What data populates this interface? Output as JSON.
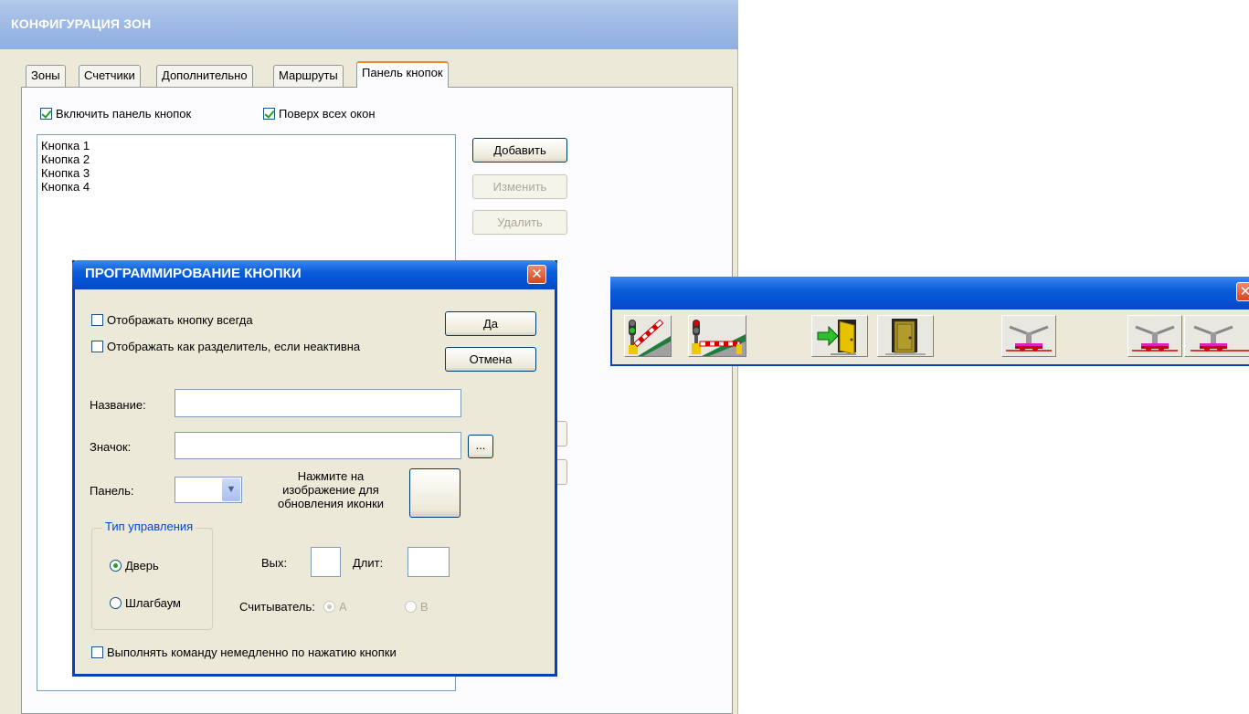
{
  "main_window": {
    "title": "КОНФИГУРАЦИЯ ЗОН",
    "tabs": [
      {
        "label": "Зоны",
        "active": false
      },
      {
        "label": "Счетчики",
        "active": false
      },
      {
        "label": "Дополнительно",
        "active": false
      },
      {
        "label": "Маршруты",
        "active": false
      },
      {
        "label": "Панель кнопок",
        "active": true
      }
    ],
    "enable_panel": {
      "label": "Включить панель кнопок",
      "checked": true
    },
    "on_top": {
      "label": "Поверх всех окон",
      "checked": true
    },
    "buttons_list": [
      "Кнопка 1",
      "Кнопка 2",
      "Кнопка 3",
      "Кнопка 4"
    ],
    "add_label": "Добавить",
    "edit_label": "Изменить",
    "delete_label": "Удалить"
  },
  "dialog": {
    "title": "ПРОГРАММИРОВАНИЕ КНОПКИ",
    "show_always": {
      "label": "Отображать кнопку всегда",
      "checked": false
    },
    "show_separator": {
      "label": "Отображать как разделитель, если неактивна",
      "checked": false
    },
    "ok_label": "Да",
    "cancel_label": "Отмена",
    "name_label": "Название:",
    "name_value": "",
    "icon_label": "Значок:",
    "icon_value": "",
    "browse_label": "...",
    "panel_label": "Панель:",
    "panel_value": "",
    "icon_hint": "Нажмите на изображение для обновления иконки",
    "control_type": {
      "legend": "Тип управления",
      "options": [
        {
          "label": "Дверь",
          "selected": true
        },
        {
          "label": "Шлагбаум",
          "selected": false
        }
      ]
    },
    "out_label": "Вых:",
    "out_value": "",
    "duration_label": "Длит:",
    "duration_value": "",
    "reader_label": "Считыватель:",
    "reader_options": [
      {
        "label": "A",
        "selected": true,
        "enabled": false
      },
      {
        "label": "B",
        "selected": false,
        "enabled": false
      }
    ],
    "execute_now": {
      "label": "Выполнять команду немедленно по нажатию кнопки",
      "checked": false
    }
  },
  "toolbar_panel": {
    "buttons": [
      {
        "icon": "traffic-light-barrier-open-icon"
      },
      {
        "icon": "traffic-light-barrier-closed-icon"
      },
      {
        "icon": "door-enter-icon"
      },
      {
        "icon": "door-closed-icon"
      },
      {
        "icon": "turnstile-icon"
      },
      {
        "icon": "turnstile-icon"
      },
      {
        "icon": "turnstile-icon"
      }
    ]
  },
  "colors": {
    "xp_blue": "#0453d6",
    "window_bg": "#ece9d8",
    "active_tab_accent": "#e68b2c",
    "close_red": "#d6471f",
    "check_green": "#21a121"
  }
}
